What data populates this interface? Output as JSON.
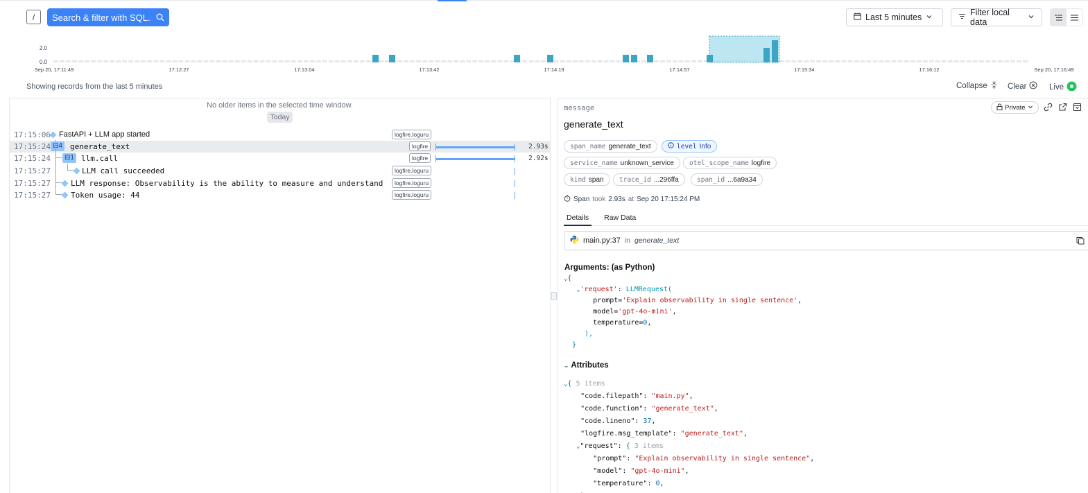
{
  "toolbar": {
    "slash_label": "/",
    "search_placeholder": "Search & filter with SQL...",
    "time_range": "Last 5 minutes",
    "filter_label": "Filter local data"
  },
  "histogram": {
    "y_ticks": [
      "2.0",
      "0.0"
    ],
    "x_ticks": [
      "Sep 20, 17:11:49",
      "17:12:27",
      "17:13:04",
      "17:13:42",
      "17:14:19",
      "17:14:57",
      "17:15:34",
      "17:16:12",
      "Sep 20, 17:16:49"
    ],
    "bar_color": "#3aa6c4"
  },
  "status": {
    "showing": "Showing records from the last 5 minutes",
    "collapse": "Collapse",
    "clear": "Clear",
    "live": "Live"
  },
  "left": {
    "no_older": "No older items in the selected time window.",
    "today": "Today",
    "rows": [
      {
        "time": "17:15:06",
        "message": "FastAPI + LLM app started",
        "tag": "logfire.loguru"
      },
      {
        "time": "17:15:24",
        "count": "4",
        "message": "generate_text",
        "tag": "logfire",
        "duration": "2.93s"
      },
      {
        "time": "17:15:24",
        "count": "1",
        "message": "llm.call",
        "tag": "logfire",
        "duration": "2.92s"
      },
      {
        "time": "17:15:27",
        "message": "LLM call succeeded",
        "tag": "logfire.loguru"
      },
      {
        "time": "17:15:27",
        "message": "LLM response: Observability is the ability to measure and understand the inte…",
        "tag": "logfire.loguru"
      },
      {
        "time": "17:15:27",
        "message": "Token usage: 44",
        "tag": "logfire.loguru"
      }
    ]
  },
  "detail": {
    "label": "message",
    "title": "generate_text",
    "private": "Private",
    "chips": [
      {
        "k": "span_name",
        "v": "generate_text"
      },
      {
        "k": "level",
        "v": "Info"
      },
      {
        "k": "service_name",
        "v": "unknown_service"
      },
      {
        "k": "otel_scope_name",
        "v": "logfire"
      },
      {
        "k": "kind",
        "v": "span"
      },
      {
        "k": "trace_id",
        "v": "...296ffa"
      },
      {
        "k": "span_id",
        "v": "...6a9a34"
      }
    ],
    "span_word": "Span",
    "took_word": "took",
    "took_value": "2.93s",
    "at_word": "at",
    "at_value": "Sep 20 17:15:24 PM",
    "tabs": [
      "Details",
      "Raw Data"
    ],
    "file": "main.py:37",
    "in_word": "in",
    "func": "generate_text",
    "arguments_title": "Arguments: (as Python)",
    "attributes_title": "Attributes",
    "attr_count": "5 items",
    "req_count": "3 items"
  }
}
